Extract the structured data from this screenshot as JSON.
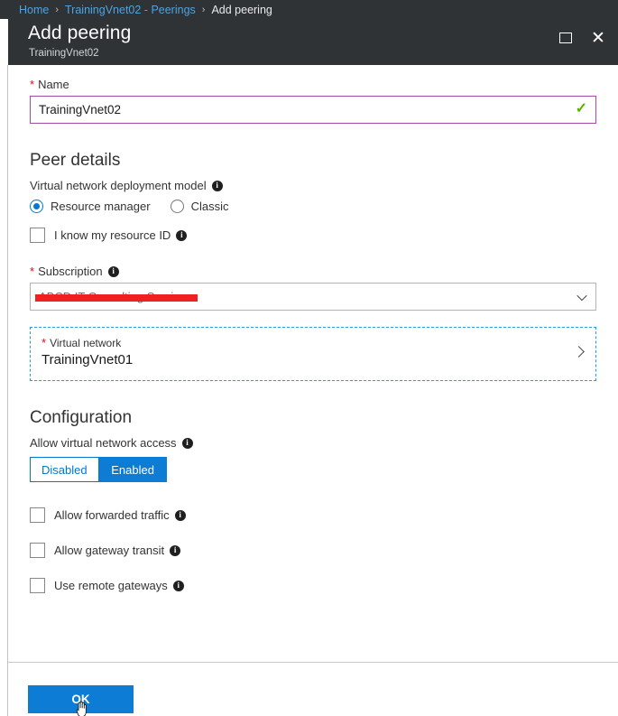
{
  "breadcrumb": {
    "items": [
      {
        "label": "Home",
        "type": "link"
      },
      {
        "label": "TrainingVnet02 - Peerings",
        "type": "link"
      },
      {
        "label": "Add peering",
        "type": "current"
      }
    ],
    "separator": "›"
  },
  "header": {
    "title": "Add peering",
    "subtitle": "TrainingVnet02",
    "restore_icon": "restore-window-icon",
    "close_icon": "close-icon"
  },
  "name_field": {
    "label": "Name",
    "required_marker": "*",
    "value": "TrainingVnet02",
    "placeholder": "",
    "valid_icon": "✓",
    "border_color": "#a64ca6",
    "valid_color": "#5cb200"
  },
  "peer_details": {
    "heading": "Peer details",
    "deployment_model": {
      "label": "Virtual network deployment model",
      "info_icon": "info-icon",
      "options": [
        {
          "label": "Resource manager",
          "selected": true
        },
        {
          "label": "Classic",
          "selected": false
        }
      ]
    },
    "know_resource_id": {
      "label": "I know my resource ID",
      "checked": false,
      "info_icon": "info-icon"
    },
    "subscription": {
      "label": "Subscription",
      "required_marker": "*",
      "info_icon": "info-icon",
      "value": "ABCD IT Consulting Services",
      "redacted": true,
      "redaction_color": "#ef2020",
      "caret_icon": "chevron-down-icon"
    },
    "virtual_network": {
      "label": "Virtual network",
      "required_marker": "*",
      "value": "TrainingVnet01",
      "caret_icon": "chevron-right-icon",
      "focus_border_color": "#1f9cf0"
    }
  },
  "configuration": {
    "heading": "Configuration",
    "allow_vnet_access": {
      "label": "Allow virtual network access",
      "info_icon": "info-icon",
      "options": [
        {
          "label": "Disabled",
          "selected": false
        },
        {
          "label": "Enabled",
          "selected": true
        }
      ]
    },
    "checkboxes": [
      {
        "label": "Allow forwarded traffic",
        "checked": false,
        "info_icon": "info-icon"
      },
      {
        "label": "Allow gateway transit",
        "checked": false,
        "info_icon": "info-icon"
      },
      {
        "label": "Use remote gateways",
        "checked": false,
        "info_icon": "info-icon"
      }
    ]
  },
  "footer": {
    "ok_label": "OK",
    "accent_color": "#0c7cd5"
  },
  "icons": {
    "info_glyph": "i"
  }
}
